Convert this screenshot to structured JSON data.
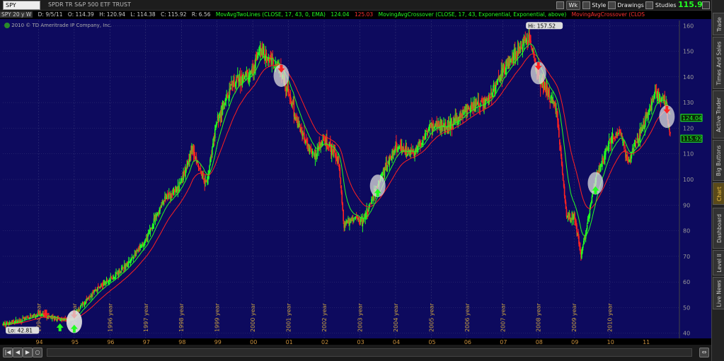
{
  "toolbar": {
    "symbol": "SPY",
    "description": "SPDR TR S&P 500 ETF TRUST",
    "timeframe_button": "Wk",
    "style_button": "Style",
    "drawings_button": "Drawings",
    "studies_button": "Studies",
    "last_price": "115.92"
  },
  "study_line": {
    "title": "SPY 20 y W",
    "date": "D: 9/5/11",
    "open": "O: 114.39",
    "high": "H: 120.94",
    "low": "L: 114.38",
    "close": "C: 115.92",
    "range": "R: 6.56",
    "ma_two_lines": "MovAvgTwoLines (CLOSE, 17, 43, 0, EMA)",
    "ma_value_1": "124.04",
    "ma_value_2": "125.03",
    "crossover_up": "MovingAvgCrossover (CLOSE, 17, 43, Exponential, Exponential, above)",
    "crossover_down": "MovingAvgCrossover (CLOS"
  },
  "copyright": "2010 © TD Ameritrade IP Company, Inc.",
  "side_tabs": [
    "Trade",
    "Times And Sales",
    "Active Trader",
    "Big Buttons",
    "Chart",
    "Dashboard",
    "Level II",
    "Live News"
  ],
  "colors": {
    "background": "#0d0a5e",
    "grid": "#3a3a7a",
    "candle_up": "#22ff22",
    "candle_down": "#ff2222",
    "ema_fast": "#22ff22",
    "ema_slow": "#ff2020",
    "axis_text": "#999999",
    "year_text": "#c8a040",
    "hi_lo_bg": "#dddddd"
  },
  "chart_data": {
    "type": "candlestick",
    "ylim": [
      38,
      162
    ],
    "y_ticks": [
      40,
      50,
      60,
      70,
      80,
      90,
      100,
      110,
      120,
      130,
      140,
      150,
      160
    ],
    "x_range": [
      1993.0,
      2011.95
    ],
    "x_ticks": [
      {
        "label": "94",
        "x": 1994.0
      },
      {
        "label": "95",
        "x": 1995.0
      },
      {
        "label": "96",
        "x": 1996.0
      },
      {
        "label": "97",
        "x": 1997.0
      },
      {
        "label": "98",
        "x": 1998.0
      },
      {
        "label": "99",
        "x": 1999.0
      },
      {
        "label": "00",
        "x": 2000.0
      },
      {
        "label": "01",
        "x": 2001.0
      },
      {
        "label": "02",
        "x": 2002.0
      },
      {
        "label": "03",
        "x": 2003.0
      },
      {
        "label": "04",
        "x": 2004.0
      },
      {
        "label": "05",
        "x": 2005.0
      },
      {
        "label": "06",
        "x": 2006.0
      },
      {
        "label": "07",
        "x": 2007.0
      },
      {
        "label": "08",
        "x": 2008.0
      },
      {
        "label": "09",
        "x": 2009.0
      },
      {
        "label": "10",
        "x": 2010.0
      },
      {
        "label": "11",
        "x": 2011.0
      }
    ],
    "year_markers": [
      {
        "label": "1994 year",
        "x": 1994.0
      },
      {
        "label": "1995 year",
        "x": 1995.0
      },
      {
        "label": "1996 year",
        "x": 1996.0
      },
      {
        "label": "1997 year",
        "x": 1997.0
      },
      {
        "label": "1998 year",
        "x": 1998.0
      },
      {
        "label": "1999 year",
        "x": 1999.0
      },
      {
        "label": "2000 year",
        "x": 2000.0
      },
      {
        "label": "2001 year",
        "x": 2001.0
      },
      {
        "label": "2002 year",
        "x": 2002.0
      },
      {
        "label": "2003 year",
        "x": 2003.0
      },
      {
        "label": "2004 year",
        "x": 2004.0
      },
      {
        "label": "2005 year",
        "x": 2005.0
      },
      {
        "label": "2006 year",
        "x": 2006.0
      },
      {
        "label": "2007 year",
        "x": 2007.0
      },
      {
        "label": "2008 year",
        "x": 2008.0
      },
      {
        "label": "2009 year",
        "x": 2009.0
      },
      {
        "label": "2010 year",
        "x": 2010.0
      }
    ],
    "price_path": [
      [
        1993.0,
        43.5
      ],
      [
        1993.5,
        45.0
      ],
      [
        1994.0,
        47.5
      ],
      [
        1994.5,
        45.5
      ],
      [
        1994.9,
        45.0
      ],
      [
        1995.5,
        56.0
      ],
      [
        1996.0,
        61.0
      ],
      [
        1996.5,
        67.0
      ],
      [
        1997.0,
        76.0
      ],
      [
        1997.5,
        92.0
      ],
      [
        1997.9,
        96.0
      ],
      [
        1998.3,
        112.0
      ],
      [
        1998.7,
        98.0
      ],
      [
        1999.0,
        123.0
      ],
      [
        1999.5,
        138.0
      ],
      [
        1999.9,
        140.0
      ],
      [
        2000.2,
        150.0
      ],
      [
        2000.8,
        143.0
      ],
      [
        2001.2,
        124.0
      ],
      [
        2001.7,
        109.0
      ],
      [
        2002.0,
        115.0
      ],
      [
        2002.4,
        108.0
      ],
      [
        2002.55,
        82.0
      ],
      [
        2002.8,
        85.0
      ],
      [
        2003.1,
        84.0
      ],
      [
        2003.5,
        98.0
      ],
      [
        2004.0,
        113.0
      ],
      [
        2004.5,
        110.0
      ],
      [
        2005.0,
        121.0
      ],
      [
        2005.5,
        121.0
      ],
      [
        2006.0,
        127.0
      ],
      [
        2006.6,
        131.0
      ],
      [
        2007.0,
        142.0
      ],
      [
        2007.4,
        150.0
      ],
      [
        2007.75,
        155.0
      ],
      [
        2008.0,
        140.0
      ],
      [
        2008.5,
        128.0
      ],
      [
        2008.8,
        85.0
      ],
      [
        2009.0,
        86.0
      ],
      [
        2009.2,
        70.0
      ],
      [
        2009.6,
        100.0
      ],
      [
        2010.0,
        115.0
      ],
      [
        2010.3,
        118.0
      ],
      [
        2010.5,
        106.0
      ],
      [
        2010.9,
        120.0
      ],
      [
        2011.3,
        134.0
      ],
      [
        2011.55,
        130.0
      ],
      [
        2011.7,
        115.92
      ]
    ],
    "series": [
      {
        "name": "EMA 17",
        "values": "fast exponential moving average of weekly close"
      },
      {
        "name": "EMA 43",
        "values": "slow exponential moving average of weekly close"
      }
    ],
    "annotations": [
      {
        "label": "Hi: 157.52",
        "x": 2007.77,
        "y": 157.52
      },
      {
        "label": "Lo: 42.81",
        "x": 1993.1,
        "y": 42.81
      }
    ],
    "crossover_signals": [
      {
        "type": "sell",
        "x": 1994.2,
        "y": 47.0
      },
      {
        "type": "buy",
        "x": 1994.6,
        "y": 43.0
      },
      {
        "type": "sell",
        "x": 1995.0,
        "y": 46.5,
        "circled": true
      },
      {
        "type": "buy",
        "x": 1995.0,
        "y": 42.5,
        "circled": true
      },
      {
        "type": "sell",
        "x": 2000.8,
        "y": 142.5,
        "circled": true
      },
      {
        "type": "buy",
        "x": 2003.5,
        "y": 95.5,
        "circled": true
      },
      {
        "type": "sell",
        "x": 2008.0,
        "y": 143.5,
        "circled": true
      },
      {
        "type": "buy",
        "x": 2009.6,
        "y": 96.5,
        "circled": true
      },
      {
        "type": "sell",
        "x": 2011.6,
        "y": 126.5,
        "circled": true
      }
    ],
    "price_labels": [
      {
        "value": "124.04",
        "y": 124.04,
        "color": "#22ff22"
      },
      {
        "value": "115.92",
        "y": 115.92,
        "color": "#22ff22"
      }
    ]
  }
}
